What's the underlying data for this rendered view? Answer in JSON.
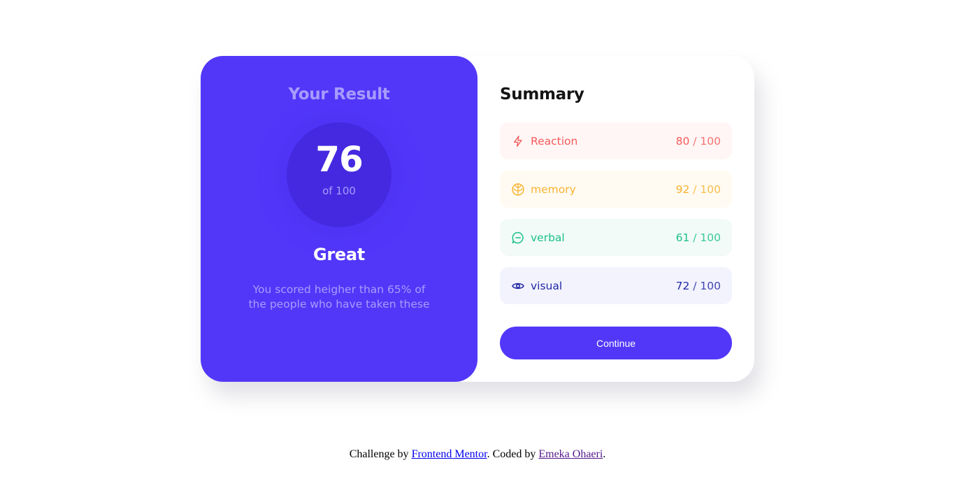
{
  "result": {
    "title": "Your Result",
    "score": "76",
    "total": "of 100",
    "rating": "Great",
    "description": "You scored heigher than 65% of the people who have taken these"
  },
  "summary": {
    "title": "Summary",
    "items": [
      {
        "label": "Reaction",
        "score": "80",
        "max": " / 100",
        "icon": "lightning-icon",
        "color": "#f55c5c",
        "bg": "#fff6f5"
      },
      {
        "label": "memory",
        "score": "92",
        "max": " / 100",
        "icon": "brain-icon",
        "color": "#f9b231",
        "bg": "#fffbf2"
      },
      {
        "label": "verbal",
        "score": "61",
        "max": " / 100",
        "icon": "chat-bubble-icon",
        "color": "#1bc08a",
        "bg": "#f2fbf8"
      },
      {
        "label": "visual",
        "score": "72",
        "max": " / 100",
        "icon": "eye-icon",
        "color": "#2026a3",
        "bg": "#f2f3fd"
      }
    ],
    "continue_label": "Continue"
  },
  "footer": {
    "prefix": "Challenge by ",
    "link1": "Frontend Mentor",
    "middle": ". Coded by ",
    "link2": "Emeka Ohaeri",
    "suffix": "."
  },
  "colors": {
    "primary": "#5237f9",
    "circle": "#4429e0",
    "muted_lavender": "#a89cfd"
  }
}
